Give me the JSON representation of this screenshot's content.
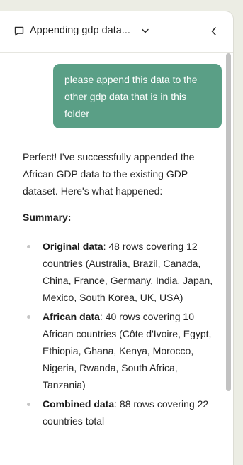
{
  "header": {
    "title": "Appending gdp data...",
    "icons": {
      "chat": "chat-bubble-icon",
      "dropdown": "chevron-down-icon",
      "collapse": "chevron-left-icon"
    }
  },
  "user_message": {
    "text": "please append this data to the other gdp data that is in this folder",
    "bubble_color": "#5a9f86"
  },
  "assistant_message": {
    "intro": "Perfect! I've successfully appended the African GDP data to the existing GDP dataset. Here's what happened:",
    "summary_heading": "Summary:",
    "items": [
      {
        "label": "Original data",
        "text": ": 48 rows covering 12 countries (Australia, Brazil, Canada, China, France, Germany, India, Japan, Mexico, South Korea, UK, USA)"
      },
      {
        "label": "African data",
        "text": ": 40 rows covering 10 African countries (Côte d'Ivoire, Egypt, Ethiopia, Ghana, Kenya, Morocco, Nigeria, Rwanda, South Africa, Tanzania)"
      },
      {
        "label": "Combined data",
        "text": ": 88 rows covering 22 countries total"
      }
    ]
  }
}
